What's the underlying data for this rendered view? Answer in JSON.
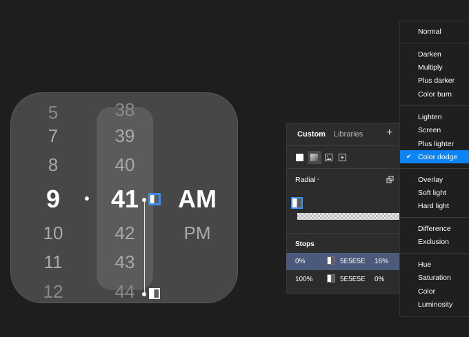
{
  "picker": {
    "hours": [
      "5",
      "7",
      "8",
      "9",
      "10",
      "11",
      "12"
    ],
    "minutes": [
      "38",
      "39",
      "40",
      "41",
      "42",
      "43",
      "44"
    ],
    "separator": "•",
    "periods": [
      "AM",
      "PM"
    ]
  },
  "panel": {
    "tabs": [
      "Custom",
      "Libraries"
    ],
    "add_label": "+",
    "gradient_type": "Radial",
    "stops_label": "Stops",
    "stops": [
      {
        "position": "0%",
        "hex": "5E5E5E",
        "opacity": "16%"
      },
      {
        "position": "100%",
        "hex": "5E5E5E",
        "opacity": "0%"
      }
    ]
  },
  "menu": {
    "groups": [
      [
        "Normal"
      ],
      [
        "Darken",
        "Multiply",
        "Plus darker",
        "Color burn"
      ],
      [
        "Lighten",
        "Screen",
        "Plus lighter",
        "Color dodge"
      ],
      [
        "Overlay",
        "Soft light",
        "Hard light"
      ],
      [
        "Difference",
        "Exclusion"
      ],
      [
        "Hue",
        "Saturation",
        "Color",
        "Luminosity"
      ]
    ],
    "selected": "Color dodge",
    "check": "✔"
  },
  "colors": {
    "accent": "#0d84f5",
    "stop_color": "#5E5E5E",
    "selected_stop_row": "#4b5a7a"
  }
}
